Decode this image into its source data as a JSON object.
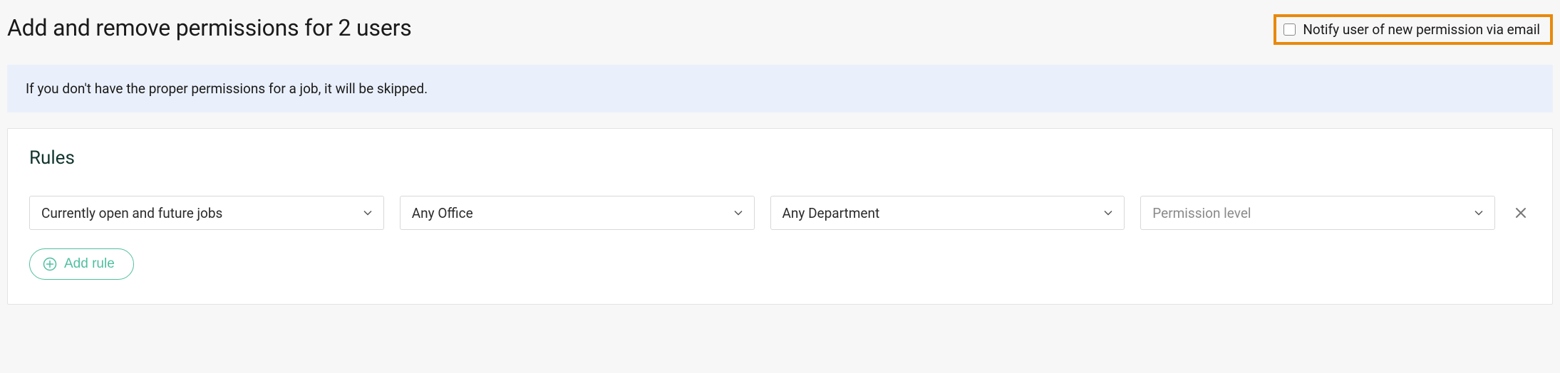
{
  "header": {
    "title": "Add and remove permissions for 2 users",
    "notify_label": "Notify user of new permission via email"
  },
  "banner": {
    "message": "If you don't have the proper permissions for a job, it will be skipped."
  },
  "rules": {
    "heading": "Rules",
    "add_rule_label": "Add rule",
    "rows": [
      {
        "jobs_select": "Currently open and future jobs",
        "office_select": "Any Office",
        "department_select": "Any Department",
        "permission_placeholder": "Permission level"
      }
    ]
  }
}
